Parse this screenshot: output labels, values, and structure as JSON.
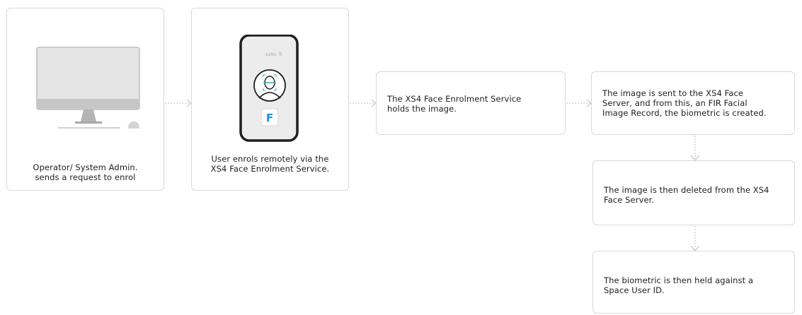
{
  "steps": {
    "operator": "Operator/ System Admin.\nsends a request to enrol",
    "user_enrol": "User enrols remotely via the\nXS4 Face Enrolment Service.",
    "service_holds": "The XS4 Face Enrolment Service\nholds the image.",
    "sent_to_server": "The image is sent to the XS4 Face\nServer, and from this, an FIR Facial\nImage Record, the biometric is created.",
    "deleted": "The image is then deleted from the XS4\nFace Server.",
    "held_against": "The biometric is then held against a\nSpace User ID."
  },
  "phone": {
    "brand": "salto",
    "app_letter": "F"
  },
  "colors": {
    "box_border": "#d9d9d9",
    "monitor_screen": "#e2e2e2",
    "monitor_stand": "#b9b9b9",
    "phone_body": "#1f1f1f",
    "phone_screen": "#ececec",
    "scan_line": "#3aa9a0",
    "app_blue": "#1a8fe0",
    "arrow": "#bdbdbd"
  },
  "icons": [
    "desktop-monitor-icon",
    "smartphone-icon",
    "face-scan-icon",
    "app-f-icon",
    "dotted-arrow-icon"
  ]
}
